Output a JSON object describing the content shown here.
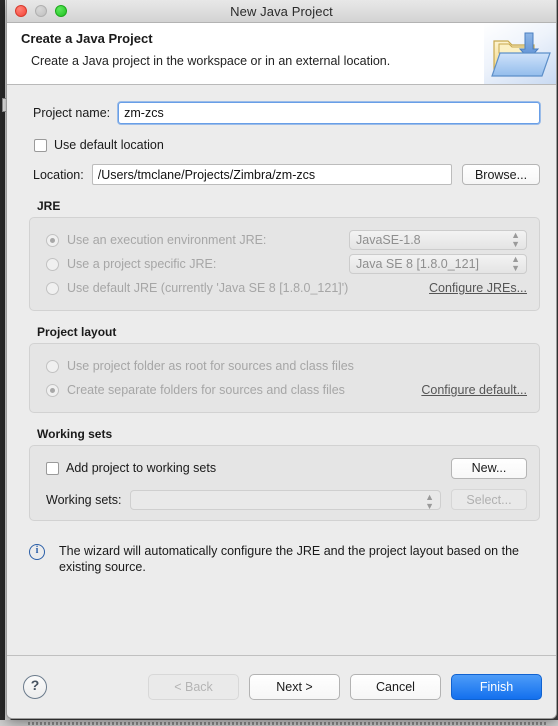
{
  "window": {
    "title": "New Java Project",
    "traffic_lights": [
      "close-red",
      "minimize-disabled",
      "zoom-green"
    ]
  },
  "header": {
    "title": "Create a Java Project",
    "description": "Create a Java project in the workspace or in an external location.",
    "icon": "java-project-folder-icon"
  },
  "form": {
    "project_name_label": "Project name:",
    "project_name_value": "zm-zcs",
    "project_name_placeholder": "",
    "use_default_location_label": "Use default location",
    "use_default_location_checked": false,
    "location_label": "Location:",
    "location_value": "/Users/tmclane/Projects/Zimbra/zm-zcs",
    "location_placeholder": "",
    "browse_label": "Browse..."
  },
  "jre": {
    "group_title": "JRE",
    "options": [
      {
        "label": "Use an execution environment JRE:",
        "selected": true,
        "combo": "JavaSE-1.8"
      },
      {
        "label": "Use a project specific JRE:",
        "selected": false,
        "combo": "Java SE 8 [1.8.0_121]"
      },
      {
        "label": "Use default JRE (currently 'Java SE 8 [1.8.0_121]')",
        "selected": false,
        "combo": null
      }
    ],
    "configure_link": "Configure JREs..."
  },
  "project_layout": {
    "group_title": "Project layout",
    "options": [
      {
        "label": "Use project folder as root for sources and class files",
        "selected": false
      },
      {
        "label": "Create separate folders for sources and class files",
        "selected": true
      }
    ],
    "configure_link": "Configure default..."
  },
  "working_sets": {
    "group_title": "Working sets",
    "add_checkbox_label": "Add project to working sets",
    "add_checkbox_checked": false,
    "new_button": "New...",
    "sets_label": "Working sets:",
    "sets_value": "",
    "select_button": "Select..."
  },
  "info": {
    "icon": "info-circle-icon",
    "message": "The wizard will automatically configure the JRE and the project layout based on the existing source."
  },
  "footer": {
    "help_label": "?",
    "back_label": "< Back",
    "next_label": "Next >",
    "cancel_label": "Cancel",
    "finish_label": "Finish"
  },
  "colors": {
    "accent": "#1370ee",
    "dialog_bg": "#ececec",
    "focus_ring": "#7aa9e8",
    "info_blue": "#2b5fa8"
  }
}
